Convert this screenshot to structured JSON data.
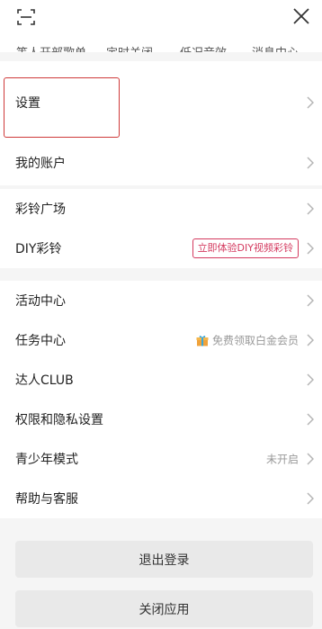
{
  "top_bar": {
    "scan_icon": "scan-icon",
    "close_icon": "close-icon",
    "shortcuts": [
      "等人开部歌单",
      "定时关闭",
      "低况音效",
      "消息中心"
    ]
  },
  "settings_group": {
    "settings_label": "设置"
  },
  "account_group": {
    "account_label": "我的账户"
  },
  "ringtone_group": {
    "ringtone_plaza_label": "彩铃广场",
    "diy_ringtone_label": "DIY彩铃",
    "diy_badge": "立即体验DIY视频彩铃"
  },
  "center_group": {
    "activity_center_label": "活动中心",
    "task_center_label": "任务中心",
    "task_center_hint": "免费领取白金会员",
    "club_label": "达人CLUB",
    "privacy_label": "权限和隐私设置",
    "youth_mode_label": "青少年模式",
    "youth_mode_status": "未开启",
    "help_label": "帮助与客服"
  },
  "actions": {
    "logout_label": "退出登录",
    "close_app_label": "关闭应用"
  },
  "colors": {
    "accent": "#d43a5f",
    "highlight": "#cf3a3a",
    "background": "#f5f5f5"
  }
}
